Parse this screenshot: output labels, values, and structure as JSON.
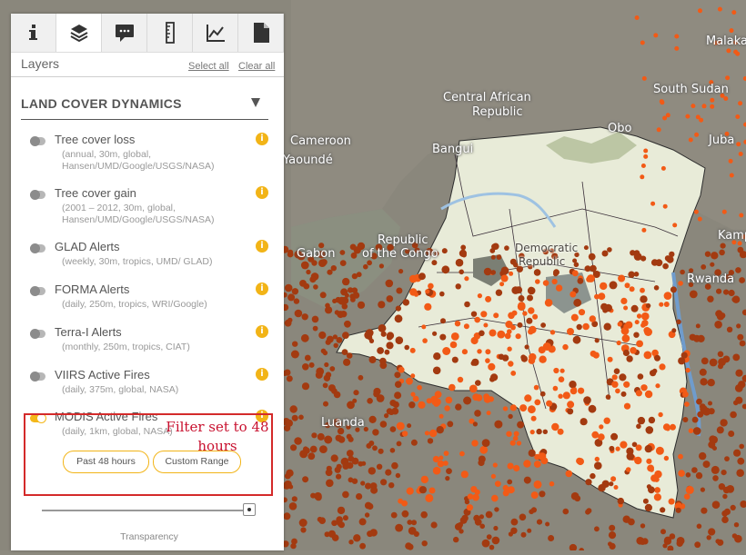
{
  "map": {
    "labels": {
      "malakal": "Malakal",
      "south_sudan": "South Sudan",
      "central_african_republic_line1": "Central African",
      "central_african_republic_line2": "Republic",
      "cameroon": "Cameroon",
      "yaounde": "Yaoundé",
      "bangui": "Bangui",
      "obo": "Obo",
      "juba": "Juba",
      "gabon": "Gabon",
      "republic_of_the_congo_line1": "Republic",
      "republic_of_the_congo_line2": "of the Congo",
      "democratic_line1": "Democratic",
      "democratic_line2": "Republic",
      "kampala": "Kamp",
      "rwanda": "Rwanda",
      "luanda": "Luanda"
    },
    "colors": {
      "background": "#8d8a7f",
      "drc_fill": "#e9ecd9",
      "fire_dot_dark": "#a33a10",
      "fire_dot_bright": "#f25a16",
      "lake": "#7ea7d6"
    }
  },
  "panel": {
    "tabs": [
      {
        "icon": "info-icon",
        "active": false
      },
      {
        "icon": "layers-icon",
        "active": true
      },
      {
        "icon": "comment-icon",
        "active": false
      },
      {
        "icon": "ruler-icon",
        "active": false
      },
      {
        "icon": "chart-icon",
        "active": false
      },
      {
        "icon": "document-icon",
        "active": false
      }
    ],
    "layers_title": "Layers",
    "select_all": "Select all",
    "clear_all": "Clear all",
    "group_title": "LAND COVER DYNAMICS",
    "layers": [
      {
        "name": "Tree cover loss",
        "desc": "(annual, 30m, global, Hansen/UMD/Google/USGS/NASA)",
        "enabled": false
      },
      {
        "name": "Tree cover gain",
        "desc": "(2001 – 2012, 30m, global, Hansen/UMD/Google/USGS/NASA)",
        "enabled": false
      },
      {
        "name": "GLAD Alerts",
        "desc": "(weekly, 30m, tropics, UMD/ GLAD)",
        "enabled": false
      },
      {
        "name": "FORMA Alerts",
        "desc": "(daily, 250m, tropics, WRI/Google)",
        "enabled": false
      },
      {
        "name": "Terra-I Alerts",
        "desc": "(monthly, 250m, tropics, CIAT)",
        "enabled": false
      },
      {
        "name": "VIIRS Active Fires",
        "desc": "(daily, 375m, global, NASA)",
        "enabled": false
      },
      {
        "name": "MODIS Active Fires",
        "desc": "(daily, 1km, global, NASA)",
        "enabled": true
      }
    ],
    "buttons": {
      "past_48": "Past 48 hours",
      "custom_range": "Custom Range"
    },
    "annotation": "Filter set to 48 hours",
    "transparency_label": "Transparency",
    "accent": "#f2b417",
    "highlight": "#d42a2a"
  }
}
